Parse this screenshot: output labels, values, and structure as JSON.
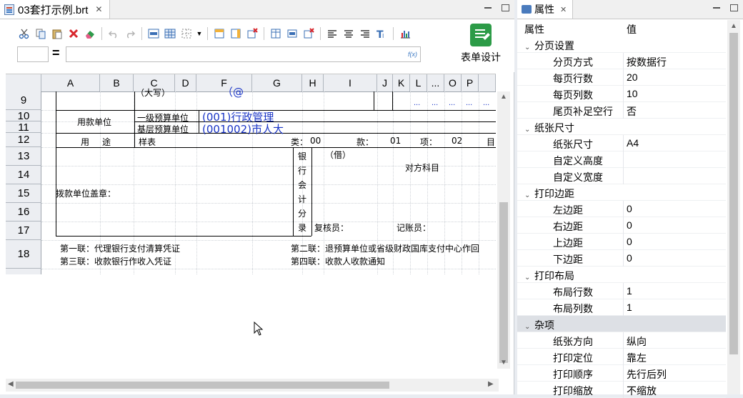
{
  "editor": {
    "tab_title": "03套打示例.brt",
    "tab_close": "✕",
    "design_button_label": "表单设计",
    "fx_label": "f(x)",
    "equals": "=",
    "columns": [
      "A",
      "B",
      "C",
      "D",
      "F",
      "G",
      "H",
      "I",
      "J",
      "K",
      "L",
      "...",
      "O",
      "P"
    ],
    "rows": [
      "9",
      "10",
      "11",
      "12",
      "13",
      "14",
      "15",
      "16",
      "17",
      "18"
    ],
    "form": {
      "row9_partial_1": "（大写）",
      "row9_partial_2": "（@",
      "payee_unit": "用款单位",
      "level1_unit_label": "一级预算单位",
      "level1_unit_value": "(001)行政管理",
      "base_unit_label": "基层预算单位",
      "base_unit_value": "(001002)市人大",
      "purpose_label": "用",
      "purpose_label2": "途",
      "purpose_value": "样表",
      "class_label": "类：",
      "class_value": "00",
      "kuan_label": "款：",
      "kuan_value": "01",
      "xiang_label": "项：",
      "xiang_value": "02",
      "mu_label": "目",
      "seal_label": "拨款单位盖章：",
      "bank_entry": [
        "银",
        "行",
        "会",
        "计",
        "分",
        "录"
      ],
      "debit": "（借）",
      "counter_account": "对方科目",
      "reviewer": "复核员：",
      "bookkeeper": "记账员：",
      "copy1": "第一联：代理银行支付清算凭证",
      "copy2": "第二联：退预算单位或省级财政国库支付中心作回",
      "copy3": "第三联：收款银行作收入凭证",
      "copy4": "第四联：收款人收款通知",
      "ellipsis": "..."
    }
  },
  "properties": {
    "tab_title": "属性",
    "tab_close": "✕",
    "col_property": "属性",
    "col_value": "值",
    "rows": [
      {
        "type": "cat",
        "label": "分页设置"
      },
      {
        "type": "item",
        "label": "分页方式",
        "value": "按数据行"
      },
      {
        "type": "item",
        "label": "每页行数",
        "value": "20"
      },
      {
        "type": "item",
        "label": "每页列数",
        "value": "10"
      },
      {
        "type": "item",
        "label": "尾页补足空行",
        "value": "否"
      },
      {
        "type": "cat",
        "label": "纸张尺寸"
      },
      {
        "type": "item",
        "label": "纸张尺寸",
        "value": "A4"
      },
      {
        "type": "item",
        "label": "自定义高度",
        "value": ""
      },
      {
        "type": "item",
        "label": "自定义宽度",
        "value": ""
      },
      {
        "type": "cat",
        "label": "打印边距"
      },
      {
        "type": "item",
        "label": "左边距",
        "value": "0"
      },
      {
        "type": "item",
        "label": "右边距",
        "value": "0"
      },
      {
        "type": "item",
        "label": "上边距",
        "value": "0"
      },
      {
        "type": "item",
        "label": "下边距",
        "value": "0"
      },
      {
        "type": "cat",
        "label": "打印布局"
      },
      {
        "type": "item",
        "label": "布局行数",
        "value": "1"
      },
      {
        "type": "item",
        "label": "布局列数",
        "value": "1"
      },
      {
        "type": "cat",
        "label": "杂项",
        "selected": true
      },
      {
        "type": "item",
        "label": "纸张方向",
        "value": "纵向"
      },
      {
        "type": "item",
        "label": "打印定位",
        "value": "靠左"
      },
      {
        "type": "item",
        "label": "打印顺序",
        "value": "先行后列"
      },
      {
        "type": "item",
        "label": "打印缩放",
        "value": "不缩放"
      }
    ]
  }
}
